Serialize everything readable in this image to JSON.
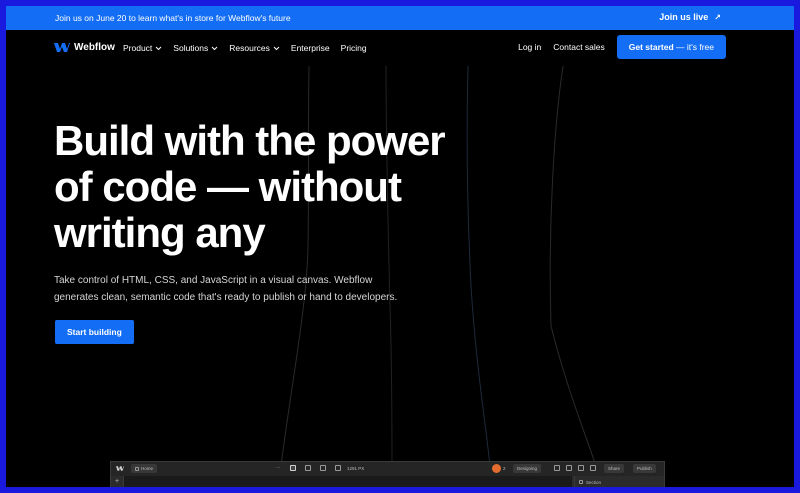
{
  "banner": {
    "message": "Join us on June 20 to learn what's in store for Webflow's future",
    "link_label": "Join us live"
  },
  "nav": {
    "brand": "Webflow",
    "links": [
      {
        "label": "Product"
      },
      {
        "label": "Solutions"
      },
      {
        "label": "Resources"
      },
      {
        "label": "Enterprise"
      },
      {
        "label": "Pricing"
      }
    ],
    "login": "Log in",
    "contact": "Contact sales",
    "cta_bold": "Get started",
    "cta_rest": " — it's free"
  },
  "hero": {
    "title_line1": "Build with the power",
    "title_line2": "of code — without",
    "title_line3": "writing any",
    "subtitle_line1": "Take control of HTML, CSS, and JavaScript in a visual canvas. Webflow",
    "subtitle_line2": "generates clean, semantic code that's ready to publish or hand to developers.",
    "button": "Start building"
  },
  "designer": {
    "home": "Home",
    "dims": "1291 PX",
    "avatar_count": "2",
    "mode": "Designing",
    "share": "Share",
    "publish": "Publish",
    "panel_left": "+",
    "panel_right": "Section"
  },
  "colors": {
    "brand_blue": "#146ef5",
    "outer_frame": "#1a1adf",
    "background": "#000000"
  }
}
